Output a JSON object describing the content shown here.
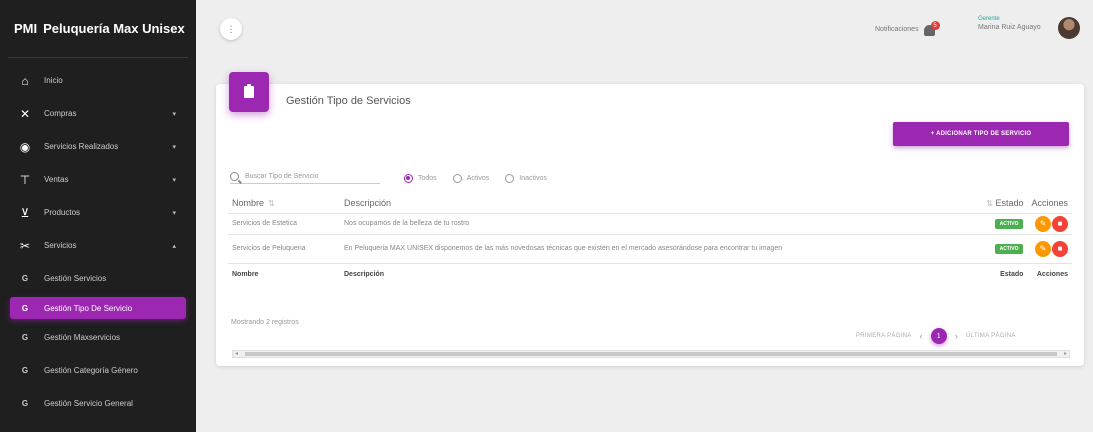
{
  "brand": {
    "abbr": "PMI",
    "name": "Peluquería Max Unisex"
  },
  "sidebar": {
    "items": [
      {
        "label": "Inicio",
        "icon": "home-icon",
        "glyph": "⌂",
        "caret": ""
      },
      {
        "label": "Compras",
        "icon": "cart-icon",
        "glyph": "✕",
        "caret": "▾"
      },
      {
        "label": "Servicios Realizados",
        "icon": "eye-icon",
        "glyph": "◉",
        "caret": "▾"
      },
      {
        "label": "Ventas",
        "icon": "shopping-cart-icon",
        "glyph": "⊤",
        "caret": "▾"
      },
      {
        "label": "Productos",
        "icon": "basket-icon",
        "glyph": "⊻",
        "caret": "▾"
      },
      {
        "label": "Servicios",
        "icon": "scissors-icon",
        "glyph": "✂",
        "caret": "▴"
      }
    ],
    "subitems": [
      {
        "letter": "G",
        "label": "Gestión Servicios",
        "active": false
      },
      {
        "letter": "G",
        "label": "Gestión Tipo De Servicio",
        "active": true
      },
      {
        "letter": "G",
        "label": "Gestión Maxservicios",
        "active": false
      },
      {
        "letter": "G",
        "label": "Gestión Categoría Género",
        "active": false
      },
      {
        "letter": "G",
        "label": "Gestión Servicio General",
        "active": false
      }
    ]
  },
  "topbar": {
    "menu_glyph": "⋮",
    "notifications_label": "Notificaciones",
    "notifications_count": "5",
    "user_role": "Gerente",
    "user_name": "Marina Ruiz Aguayo"
  },
  "card": {
    "title": "Gestión Tipo de Servicios",
    "add_button": "+ ADICIONAR TIPO DE SERVICIO"
  },
  "filters": {
    "search_placeholder": "Buscar Tipo de Servicio",
    "options": [
      "Todos",
      "Activos",
      "Inactivos"
    ],
    "selected": "Todos"
  },
  "table": {
    "headers": {
      "nombre": "Nombre",
      "descripcion": "Descripción",
      "estado": "Estado",
      "acciones": "Acciones"
    },
    "rows": [
      {
        "nombre": "Servicios de Estetica",
        "descripcion": "Nos ocupamos de la belleza de tu rostro",
        "estado": "ACTIVO"
      },
      {
        "nombre": "Servicios de Peluqueria",
        "descripcion": "En Peluqueria MAX UNISEX disponemos de las más novedosas técnicas que existen en el mercado asesorándose para encontrar tu imagen",
        "estado": "ACTIVO"
      }
    ],
    "footer_headers": {
      "nombre": "Nombre",
      "descripcion": "Descripción",
      "estado": "Estado",
      "acciones": "Acciones"
    }
  },
  "showing": "Mostrando 2 registros",
  "pagination": {
    "first": "PRIMERA PÁGINA",
    "current": "1",
    "last": "ÚLTIMA PÁGINA"
  },
  "colors": {
    "accent": "#9c27b0",
    "sidebar": "#1f1f1f",
    "active_badge": "#4caf50",
    "edit": "#ff9800",
    "delete": "#f44336"
  }
}
